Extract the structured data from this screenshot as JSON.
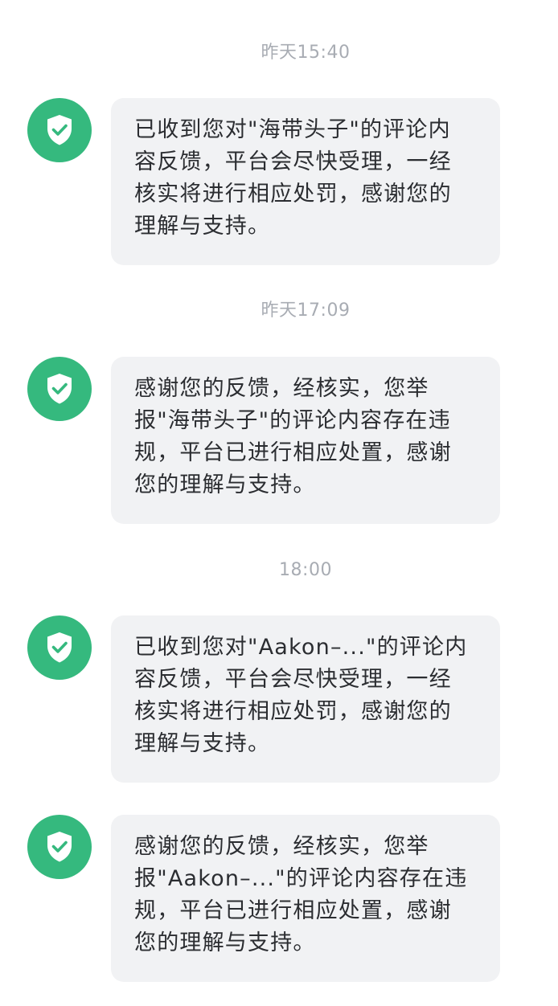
{
  "messages": [
    {
      "time": "昨天15:40",
      "lines": [
        "已收到您对\"海带头子\"的评论内",
        "容反馈，平台会尽快受理，一经",
        "核实将进行相应处罚，感谢您的",
        "理解与支持。"
      ]
    },
    {
      "time": "昨天17:09",
      "lines": [
        "感谢您的反馈，经核实，您举",
        "报\"海带头子\"的评论内容存在违",
        "规，平台已进行相应处置，感谢",
        "您的理解与支持。"
      ]
    },
    {
      "time": "18:00",
      "lines": [
        "已收到您对\"Aakon–...\"的评论内",
        "容反馈，平台会尽快受理，一经",
        "核实将进行相应处罚，感谢您的",
        "理解与支持。"
      ]
    },
    {
      "time": "",
      "lines": [
        "感谢您的反馈，经核实，您举",
        "报\"Aakon–...\"的评论内容存在违",
        "规，平台已进行相应处置，感谢",
        "您的理解与支持。"
      ]
    }
  ],
  "avatar": {
    "icon": "shield-check-icon",
    "color": "#35b97e"
  }
}
